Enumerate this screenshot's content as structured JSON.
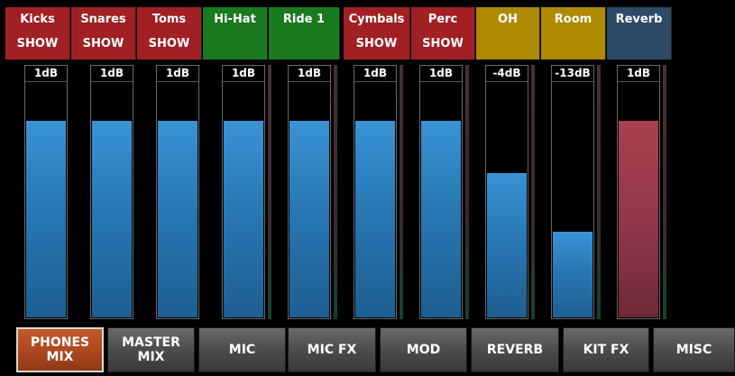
{
  "channels": [
    {
      "name": "Kicks",
      "show": "SHOW",
      "color": "#a02024",
      "db": "1dB",
      "level": 0.78
    },
    {
      "name": "Snares",
      "show": "SHOW",
      "color": "#a02024",
      "db": "1dB",
      "level": 0.78
    },
    {
      "name": "Toms",
      "show": "SHOW",
      "color": "#a02024",
      "db": "1dB",
      "level": 0.78
    },
    {
      "name": "Hi-Hat",
      "show": "",
      "color": "#1a7a1f",
      "db": "1dB",
      "level": 0.78
    },
    {
      "name": "Ride 1",
      "show": "",
      "color": "#1a7a1f",
      "db": "1dB",
      "level": 0.78
    },
    {
      "name": "Cymbals",
      "show": "SHOW",
      "color": "#a02024",
      "db": "1dB",
      "level": 0.78
    },
    {
      "name": "Perc",
      "show": "SHOW",
      "color": "#a02024",
      "db": "1dB",
      "level": 0.78
    },
    {
      "name": "OH",
      "show": "",
      "color": "#ad8a00",
      "db": "-4dB",
      "level": 0.57
    },
    {
      "name": "Room",
      "show": "",
      "color": "#ad8a00",
      "db": "-13dB",
      "level": 0.34
    },
    {
      "name": "Reverb",
      "show": "",
      "color": "#2d4a66",
      "db": "1dB",
      "level": 0.78,
      "fill": "red"
    }
  ],
  "nav": [
    {
      "label": "PHONES\nMIX",
      "active": true
    },
    {
      "label": "MASTER\nMIX",
      "active": false
    },
    {
      "label": "MIC",
      "active": false
    },
    {
      "label": "MIC FX",
      "active": false
    },
    {
      "label": "MOD",
      "active": false
    },
    {
      "label": "REVERB",
      "active": false
    },
    {
      "label": "KIT FX",
      "active": false
    },
    {
      "label": "MISC",
      "active": false
    }
  ]
}
